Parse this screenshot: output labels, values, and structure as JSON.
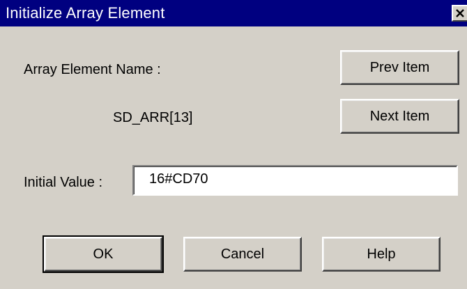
{
  "window": {
    "title": "Initialize Array Element"
  },
  "form": {
    "element_name_label": "Array Element Name :",
    "element_name_value": "SD_ARR[13]",
    "initial_value_label": "Initial Value :",
    "initial_value": "16#CD70"
  },
  "buttons": {
    "prev_item": "Prev Item",
    "next_item": "Next Item",
    "ok": "OK",
    "cancel": "Cancel",
    "help": "Help"
  },
  "colors": {
    "titlebar": "#000080",
    "dialog_bg": "#d4d0c8"
  },
  "icons": {
    "close": "close-icon"
  }
}
